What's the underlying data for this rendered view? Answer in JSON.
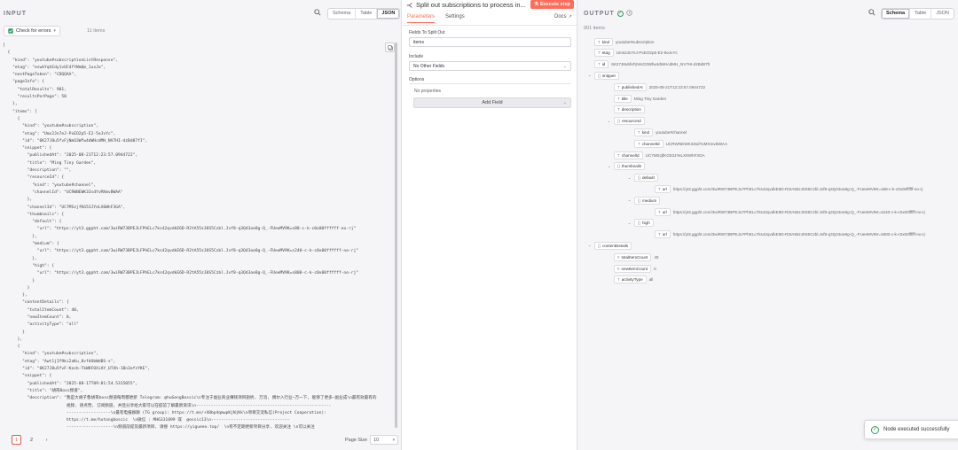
{
  "input": {
    "title": "INPUT",
    "view_tabs": [
      "Schema",
      "Table",
      "JSON"
    ],
    "active_view": "JSON",
    "check_errors_label": "Check for errors",
    "items_count": "11 items",
    "json_lines": [
      "[",
      "  {",
      "    \"kind\": \"youtube#subscriptionListResponse\",",
      "    \"etag\": \"eswkYqhEdy1vUC4fYWmQm_1uxJo\",",
      "    \"nextPageToken\": \"CDQQAA\",",
      "    \"pageInfo\": {",
      "      \"totalResults\": 901,",
      "      \"resultsPerPage\": 50",
      "    },",
      "    \"items\": [",
      "      {",
      "        \"kind\": \"youtube#subscription\",",
      "        \"etag\": \"Ums2Jn7eJ-PxEO2p5-E2-5eJvYc\",",
      "        \"id\": \"6K27J8u5fvFjNmO3Wfw4dWHcdMH_NV7HI-dzBd87fI\",",
      "        \"snippet\": {",
      "          \"publishedAt\": \"2025-08-21T12:23:57.0944722\",",
      "          \"title\": \"Ming Tiny Garden\",",
      "          \"description\": \"\",",
      "          \"resourceId\": {",
      "            \"kind\": \"youtube#channel\",",
      "            \"channelId\": \"UCRWNEWK33sdYvMXmvBWAA\"",
      "          },",
      "          \"channelId\": \"UC7MSzjfKG53JYeLX6WhF3GA\",",
      "          \"thumbnails\": {",
      "            \"default\": {",
      "              \"url\": \"https://yt3.ggpht.com/3wiRW73BPEJLFPhELc7ks42qvdkE6D-R2tA55zJ0S5Czbl.Jvf8-q3Q43oe8g-Q_-FUeeMV9K=s88-c-k-c0x00ffffff-no-rj\"",
      "            },",
      "            \"medium\": {",
      "              \"url\": \"https://yt3.ggpht.com/3wiRW73BPEJLFPhELc7ks42qvdkE6D-R2tA55zJ0S5Czbl.Jvf8-q3Q43oe8g-Q_-FUeeMV9K=s240-c-k-c0x00ffffff-no-rj\"",
      "            },",
      "            \"high\": {",
      "              \"url\": \"https://yt3.ggpht.com/3wiRW73BPEJLFPhELc7ks42qvdkE6D-R2tA55zJ0S5Czbl.Jvf8-q3Q43oe8g-Q_-FUeeMV9K=s800-c-k-c0x00ffffff-no-rj\"",
      "            }",
      "          }",
      "        },",
      "        \"contentDetails\": {",
      "          \"totalItemCount\": 40,",
      "          \"newItemCount\": 0,",
      "          \"activityType\": \"all\"",
      "        }",
      "      },",
      "      {",
      "        \"kind\": \"youtube#subscription\",",
      "        \"etag\": \"Awt1jIf9ki2aKu_8vfdUbWdBS-s\",",
      "        \"id\": \"6K27J8u5fvF-Kocb-TkWKFOXiAY_UT4h-1Bn3efzYKE\",",
      "        \"snippet\": {",
      "          \"publishedAt\": \"2025-08-17T09:01:54.5315055\",",
      "          \"title\": \"胡哥Boss频道\",",
      "          \"description\": \"我是大胡子鲁胡哥boss频道每周都更新 Telegram: @huGengBossic\\n专注于副业商业赚钱项目剖析, 万流, 偶尔入行业—万一下, 能够了更多—副业成\\n最有效最有的",
      "                          视频, 请点赞, 订阅频道, 并且分享给大家可以在提前了解最新资讯\\n-------------------------------------------------------",
      "                          ------------------\\n最有电报群聊 (TG group): https://t.me/+X0bp4qmwpKjNjKk\\n项目交流私信(Project Cooperation):",
      "                          https://t.me/hutongbossic  \\n微信 : MH6331099 或  @ossic13\\n--------------------------------",
      "                          -------------------\\n频道前提及最新项目, 请搜 https://yigueee.top/  \\n有不定期更新项目分享, 欢迎关注 \\n可以关注"
    ],
    "pager": {
      "pages": [
        "1",
        "2"
      ],
      "active_page": "1",
      "page_size_label": "Page Size",
      "page_size_value": "10"
    }
  },
  "node": {
    "title": "Split out subscriptions to process in...",
    "execute_label": "Execute step",
    "tabs": [
      "Parameters",
      "Settings"
    ],
    "active_tab": "Parameters",
    "docs_label": "Docs",
    "fields_label": "Fields To Split Out",
    "fields_value": "items",
    "include_label": "Include",
    "include_value": "No Other Fields",
    "options_label": "Options",
    "no_properties": "No properties",
    "add_field_label": "Add Field"
  },
  "output": {
    "title": "OUTPUT",
    "items_count": "901 items",
    "view_tabs": [
      "Schema",
      "Table",
      "JSON"
    ],
    "active_view": "Schema",
    "tree": [
      {
        "key": "kind",
        "type": "T",
        "value": "youtube#subscription",
        "depth": 0
      },
      {
        "key": "etag",
        "type": "T",
        "value": "Ums2Jn7eJ-PxEO2p5-E2-5eJvYc",
        "depth": 0
      },
      {
        "key": "id",
        "type": "T",
        "value": "6K27J8u5fvFjNmO3Wfw4dWHcdMH_NV7HI-dzBd87fI",
        "depth": 0
      },
      {
        "key": "snippet",
        "type": "{}",
        "value": "",
        "depth": 0,
        "caret": true
      },
      {
        "key": "publishedAt",
        "type": "T",
        "value": "2025-08-21T12:23:57.0944722",
        "depth": 1
      },
      {
        "key": "title",
        "type": "T",
        "value": "Ming Tiny Garden",
        "depth": 1
      },
      {
        "key": "description",
        "type": "T",
        "value": "",
        "depth": 1
      },
      {
        "key": "resourceId",
        "type": "{}",
        "value": "",
        "depth": 1,
        "caret": true
      },
      {
        "key": "kind",
        "type": "T",
        "value": "youtube#channel",
        "depth": 2
      },
      {
        "key": "channelId",
        "type": "T",
        "value": "UCRWNEWK33sdYvMXmvBWAA",
        "depth": 2
      },
      {
        "key": "channelId",
        "type": "T",
        "value": "UC7MSzjfKG53JYeLX6WhF3GA",
        "depth": 1
      },
      {
        "key": "thumbnails",
        "type": "{}",
        "value": "",
        "depth": 1,
        "caret": true
      },
      {
        "key": "default",
        "type": "{}",
        "value": "",
        "depth": 2,
        "caret": true
      },
      {
        "key": "url",
        "type": "T",
        "value": "https://yt3.ggpht.com/3wiRW73BPEJLFPhELc7ks42qvdkE6D-R2tA55zJ0S5Czbl.Jvf8-q3Q43oe8g-Q_-FUeeMV9K=s88-c-k-c0x00ffffff-no-rj",
        "depth": 3
      },
      {
        "key": "medium",
        "type": "{}",
        "value": "",
        "depth": 2,
        "caret": true
      },
      {
        "key": "url",
        "type": "T",
        "value": "https://yt3.ggpht.com/3wiRW73BPEJLFPhELc7ks42qvdkE6D-R2tA55zJ0S5Czbl.Jvf8-q3Q43oe8g-Q_-FUeeMV9K=s240-c-k-c0x00ffffff-no-rj",
        "depth": 3
      },
      {
        "key": "high",
        "type": "{}",
        "value": "",
        "depth": 2,
        "caret": true
      },
      {
        "key": "url",
        "type": "T",
        "value": "https://yt3.ggpht.com/3wiRW73BPEJLFPhELc7ks42qvdkE6D-R2tA55zJ0S5Czbl.Jvf8-q3Q43oe8g-Q_-FUeeMV9K=s800-c-k-c0x00ffffff-no-rj",
        "depth": 3
      },
      {
        "key": "contentDetails",
        "type": "{}",
        "value": "",
        "depth": 0,
        "caret": true
      },
      {
        "key": "totalItemCount",
        "type": "#",
        "value": "40",
        "depth": 1
      },
      {
        "key": "newItemCount",
        "type": "#",
        "value": "0",
        "depth": 1
      },
      {
        "key": "activityType",
        "type": "T",
        "value": "all",
        "depth": 1
      }
    ]
  },
  "toast": {
    "message": "Node executed successfully"
  },
  "colors": {
    "accent": "#ff6d5a",
    "success": "#2e9d5f"
  }
}
